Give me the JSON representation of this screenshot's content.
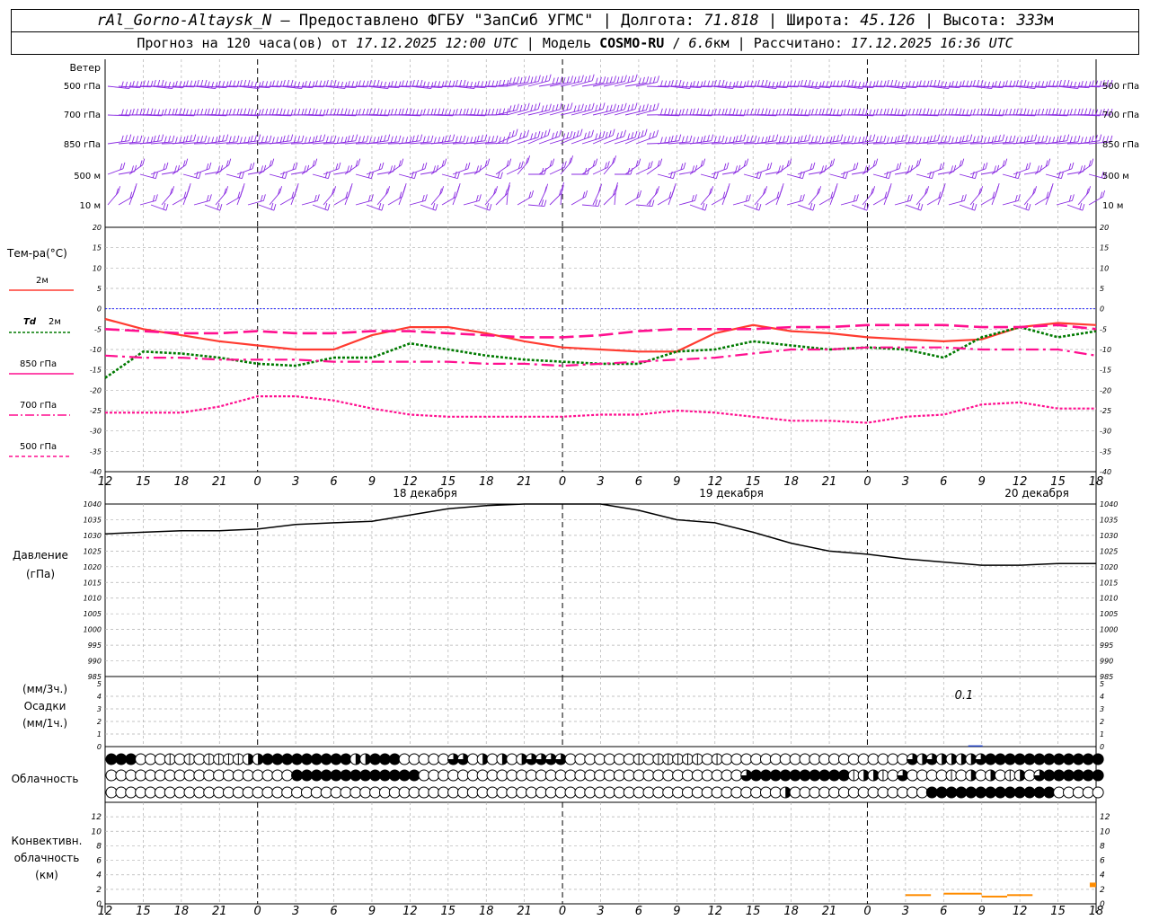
{
  "header": {
    "station": "rAl_Gorno-Altaysk_N",
    "provider": "Предоставлено ФГБУ \"ЗапСиб УГМС\"",
    "lon_label": "Долгота:",
    "lon": "71.818",
    "lat_label": "Широта:",
    "lat": "45.126",
    "alt_label": "Высота:",
    "alt": "333",
    "alt_unit": "м",
    "forecast_prefix": "Прогноз на 120 часа(ов) от",
    "forecast_start": "17.12.2025 12:00 UTC",
    "model_label": "Модель",
    "model": "COSMO-RU",
    "model_res": "6.6",
    "model_res_unit": "км",
    "calc_label": "Рассчитано:",
    "calc_time": "17.12.2025 16:36 UTC"
  },
  "labels": {
    "wind_title": "Ветер",
    "wind_levels": [
      "500 гПа",
      "700 гПа",
      "850 гПа",
      "500 м",
      "10 м"
    ],
    "wind_levels_right": [
      "500 гПа",
      "700 гПа",
      "850 гПа",
      "500 м",
      "10 м"
    ],
    "temp_title": "Тем-ра(°С)",
    "legend_2m": "2м",
    "legend_td": "Td",
    "legend_td_2m": "2м",
    "legend_850": "850 гПа",
    "legend_700": "700 гПа",
    "legend_500": "500 гПа",
    "pressure_title": "Давление",
    "pressure_unit": "(гПа)",
    "precip_unit1": "(мм/3ч.)",
    "precip_title": "Осадки",
    "precip_unit2": "(мм/1ч.)",
    "precip_annotation": "0.1",
    "cloud_title": "Облачность",
    "conv_title1": "Конвективн.",
    "conv_title2": "облачность",
    "conv_unit": "(км)",
    "day_labels": [
      "18 декабря",
      "19 декабря",
      "20 декабря"
    ]
  },
  "colors": {
    "wind": "#8a2be2",
    "t2m": "#ff3b30",
    "td2m": "#007a00",
    "t850": "#ff0f8f",
    "t700": "#ff0f8f",
    "t500": "#ff0f8f",
    "pressure": "#000000",
    "precip": "#1f3fbf",
    "conv": "#ff8c00",
    "zero_line": "#0000ff"
  },
  "chart_data": [
    {
      "type": "line",
      "title": "Тем-ра(°С)",
      "x_ticks": [
        "12",
        "15",
        "18",
        "21",
        "0",
        "3",
        "6",
        "9",
        "12",
        "15",
        "18",
        "21",
        "0",
        "3",
        "6",
        "9",
        "12",
        "15",
        "18",
        "21",
        "0",
        "3",
        "6",
        "9",
        "12",
        "15",
        "18"
      ],
      "x_hours": [
        0,
        3,
        6,
        9,
        12,
        15,
        18,
        21,
        24,
        27,
        30,
        33,
        36,
        39,
        42,
        45,
        48,
        51,
        54,
        57,
        60,
        63,
        66,
        69,
        72,
        75,
        78
      ],
      "ylim": [
        -40,
        20
      ],
      "y_ticks": [
        20,
        15,
        10,
        5,
        0,
        -5,
        -10,
        -15,
        -20,
        -25,
        -30,
        -35,
        -40
      ],
      "series": [
        {
          "name": "2м",
          "key": "t2m",
          "style": "solid",
          "x": [
            0,
            3,
            6,
            9,
            12,
            15,
            18,
            21,
            24,
            27,
            30,
            33,
            36,
            39,
            42,
            45,
            48,
            51,
            54,
            57,
            60,
            63,
            66,
            69,
            72,
            75,
            78
          ],
          "values": [
            -2.5,
            -5,
            -6.5,
            -8,
            -9,
            -10,
            -10,
            -6.5,
            -4.5,
            -4.5,
            -6,
            -8,
            -9.5,
            -10,
            -10.5,
            -10.5,
            -6,
            -4,
            -5.5,
            -6,
            -7,
            -7.5,
            -8,
            -7.5,
            -4.5,
            -3.5,
            -4
          ]
        },
        {
          "name": "Td 2м",
          "key": "td2m",
          "style": "dotted",
          "x": [
            0,
            3,
            6,
            9,
            12,
            15,
            18,
            21,
            24,
            27,
            30,
            33,
            36,
            39,
            42,
            45,
            48,
            51,
            54,
            57,
            60,
            63,
            66,
            69,
            72,
            75,
            78
          ],
          "values": [
            -17,
            -10.5,
            -11,
            -12,
            -13.5,
            -14,
            -12,
            -12,
            -8.5,
            -10,
            -11.5,
            -12.5,
            -13,
            -13.5,
            -13.5,
            -10.5,
            -10,
            -8,
            -9,
            -10,
            -9.5,
            -10,
            -12,
            -7,
            -4.5,
            -7,
            -5.5
          ]
        },
        {
          "name": "850 гПа",
          "key": "t850",
          "style": "dashed",
          "x": [
            0,
            3,
            6,
            9,
            12,
            15,
            18,
            21,
            24,
            27,
            30,
            33,
            36,
            39,
            42,
            45,
            48,
            51,
            54,
            57,
            60,
            63,
            66,
            69,
            72,
            75,
            78
          ],
          "values": [
            -5,
            -5.5,
            -6,
            -6,
            -5.5,
            -6,
            -6,
            -5.5,
            -5.5,
            -6,
            -6.5,
            -7,
            -7,
            -6.5,
            -5.5,
            -5,
            -5,
            -5,
            -4.5,
            -4.5,
            -4,
            -4,
            -4,
            -4.5,
            -4.5,
            -4,
            -5
          ]
        },
        {
          "name": "700 гПа",
          "key": "t700",
          "style": "dashdot",
          "x": [
            0,
            3,
            6,
            9,
            12,
            15,
            18,
            21,
            24,
            27,
            30,
            33,
            36,
            39,
            42,
            45,
            48,
            51,
            54,
            57,
            60,
            63,
            66,
            69,
            72,
            75,
            78
          ],
          "values": [
            -11.5,
            -12,
            -12,
            -12.5,
            -12.5,
            -12.5,
            -13,
            -13,
            -13,
            -13,
            -13.5,
            -13.5,
            -14,
            -13.5,
            -13,
            -12.5,
            -12,
            -11,
            -10,
            -10,
            -9.5,
            -9.5,
            -9.5,
            -10,
            -10,
            -10,
            -11.5
          ]
        },
        {
          "name": "500 гПа",
          "key": "t500",
          "style": "dotted",
          "x": [
            0,
            3,
            6,
            9,
            12,
            15,
            18,
            21,
            24,
            27,
            30,
            33,
            36,
            39,
            42,
            45,
            48,
            51,
            54,
            57,
            60,
            63,
            66,
            69,
            72,
            75,
            78
          ],
          "values": [
            -25.5,
            -25.5,
            -25.5,
            -24,
            -21.5,
            -21.5,
            -22.5,
            -24.5,
            -26,
            -26.5,
            -26.5,
            -26.5,
            -26.5,
            -26,
            -26,
            -25,
            -25.5,
            -26.5,
            -27.5,
            -27.5,
            -28,
            -26.5,
            -26,
            -23.5,
            -23,
            -24.5,
            -24.5
          ]
        }
      ]
    },
    {
      "type": "line",
      "title": "Давление",
      "ylabel": "(гПа)",
      "ylim": [
        985,
        1040
      ],
      "y_ticks": [
        1040,
        1035,
        1030,
        1025,
        1020,
        1015,
        1010,
        1005,
        1000,
        995,
        990,
        985
      ],
      "series": [
        {
          "name": "Давление",
          "key": "pressure",
          "x": [
            0,
            3,
            6,
            9,
            12,
            15,
            18,
            21,
            24,
            27,
            30,
            33,
            36,
            39,
            42,
            45,
            48,
            51,
            54,
            57,
            60,
            63,
            66,
            69,
            72,
            75,
            78
          ],
          "values": [
            1030.5,
            1031,
            1031.5,
            1031.5,
            1032,
            1033.5,
            1034,
            1034.5,
            1036.5,
            1038.5,
            1039.5,
            1040,
            1040,
            1040,
            1038,
            1035,
            1034,
            1031,
            1027.5,
            1025,
            1024,
            1022.5,
            1021.5,
            1020.5,
            1020.5,
            1021,
            1021
          ]
        }
      ]
    },
    {
      "type": "bar",
      "title": "Осадки",
      "ylim": [
        0,
        5
      ],
      "y_ticks": [
        5,
        4,
        3,
        2,
        1,
        0
      ],
      "series": [
        {
          "name": "Осадки",
          "key": "precip",
          "x": [
            68.5
          ],
          "values": [
            0.1
          ]
        }
      ]
    },
    {
      "type": "table",
      "title": "Облачность",
      "columns_per_row": 52,
      "rows": [
        [
          4,
          4,
          4,
          0,
          0,
          0,
          1,
          0,
          1,
          0,
          1,
          1,
          1,
          1,
          2,
          2,
          4,
          4,
          4,
          4,
          4,
          4,
          4,
          4,
          4,
          2,
          2,
          4,
          4,
          4,
          0,
          0,
          0,
          0,
          0,
          3,
          3,
          0,
          2,
          0,
          2,
          0,
          2,
          3,
          3,
          3,
          3,
          0,
          0,
          0,
          0,
          0,
          0,
          0,
          1,
          0,
          1,
          1,
          1,
          1,
          1,
          0,
          1,
          0,
          0,
          0,
          0,
          0,
          0,
          0,
          0,
          0,
          0,
          0,
          0,
          0,
          0,
          0,
          0,
          0,
          0,
          0,
          3,
          2,
          3,
          2,
          2,
          2,
          2,
          3,
          4,
          4,
          4,
          4,
          4,
          4,
          4,
          4,
          4,
          4,
          4,
          4
        ],
        [
          0,
          0,
          0,
          0,
          0,
          0,
          0,
          0,
          0,
          0,
          0,
          0,
          0,
          0,
          0,
          0,
          0,
          0,
          0,
          4,
          4,
          4,
          4,
          4,
          4,
          4,
          4,
          4,
          4,
          4,
          4,
          4,
          0,
          0,
          0,
          0,
          0,
          0,
          0,
          0,
          0,
          0,
          0,
          0,
          0,
          0,
          0,
          0,
          0,
          0,
          0,
          0,
          0,
          0,
          0,
          0,
          0,
          0,
          0,
          0,
          0,
          0,
          0,
          0,
          0,
          3,
          4,
          4,
          4,
          4,
          4,
          4,
          4,
          4,
          4,
          4,
          1,
          2,
          2,
          1,
          0,
          3,
          0,
          0,
          0,
          0,
          1,
          0,
          2,
          0,
          2,
          0,
          1,
          2,
          0,
          3,
          4,
          4,
          4,
          4,
          4,
          4
        ],
        [
          0,
          0,
          0,
          0,
          0,
          0,
          0,
          0,
          0,
          0,
          0,
          0,
          0,
          0,
          0,
          0,
          0,
          0,
          0,
          0,
          0,
          0,
          0,
          0,
          0,
          0,
          0,
          0,
          0,
          0,
          0,
          0,
          0,
          0,
          0,
          0,
          0,
          0,
          0,
          0,
          0,
          0,
          0,
          0,
          0,
          0,
          0,
          0,
          0,
          0,
          0,
          0,
          0,
          0,
          0,
          0,
          0,
          0,
          0,
          0,
          0,
          0,
          0,
          0,
          0,
          0,
          0,
          0,
          0,
          2,
          0,
          0,
          0,
          0,
          0,
          0,
          0,
          0,
          0,
          0,
          0,
          0,
          0,
          0,
          4,
          4,
          4,
          4,
          4,
          4,
          4,
          4,
          4,
          4,
          4,
          4,
          4,
          0,
          0,
          0,
          0,
          0,
          1,
          3,
          0,
          0
        ]
      ]
    },
    {
      "type": "bar",
      "title": "Конвективн. облачность",
      "ylabel": "(км)",
      "ylim": [
        0,
        14
      ],
      "y_ticks": [
        12,
        10,
        8,
        6,
        4,
        2,
        0
      ],
      "series": [
        {
          "name": "нижняя граница",
          "key": "conv",
          "segments": [
            [
              63,
              65,
              1.2
            ],
            [
              66,
              69,
              1.4
            ],
            [
              69,
              71,
              1.0
            ],
            [
              71,
              73,
              1.2
            ],
            [
              77.5,
              78,
              2.8
            ]
          ]
        }
      ]
    }
  ]
}
